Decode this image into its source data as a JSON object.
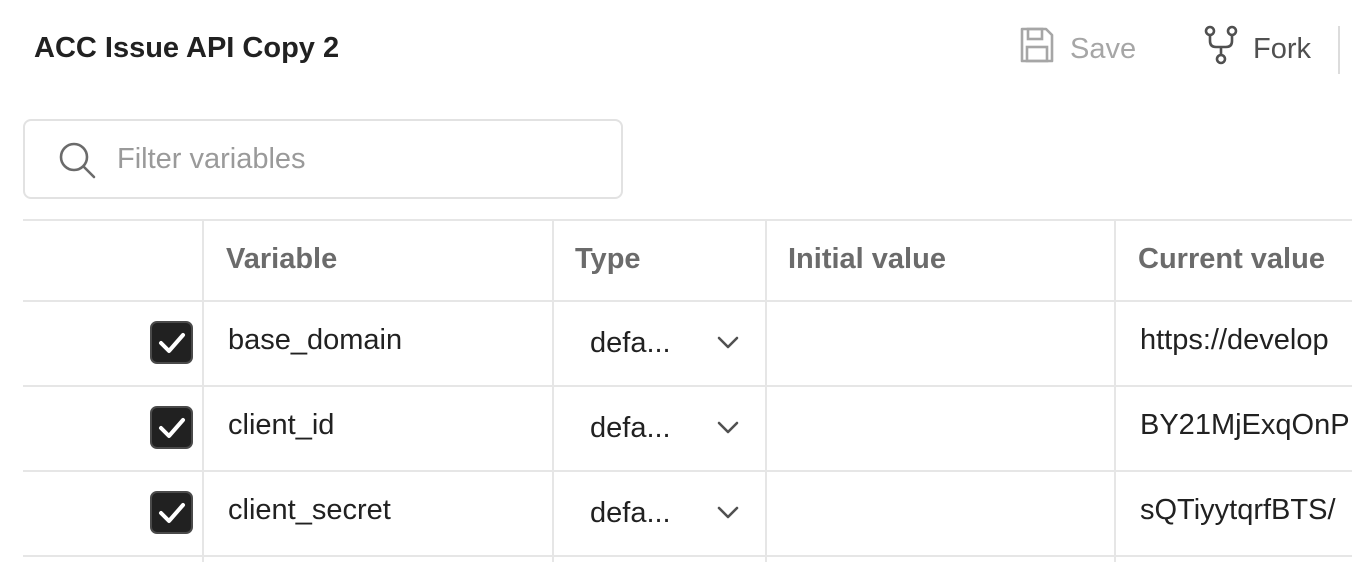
{
  "header": {
    "title": "ACC Issue API Copy 2",
    "save_label": "Save",
    "fork_label": "Fork"
  },
  "filter": {
    "placeholder": "Filter variables",
    "value": ""
  },
  "table": {
    "columns": {
      "variable": "Variable",
      "type": "Type",
      "initial_value": "Initial value",
      "current_value": "Current value"
    },
    "rows": [
      {
        "checked": true,
        "variable": "base_domain",
        "type": "defa...",
        "initial_value": "",
        "current_value": "https://develop"
      },
      {
        "checked": true,
        "variable": "client_id",
        "type": "defa...",
        "initial_value": "",
        "current_value": "BY21MjExqOnP"
      },
      {
        "checked": true,
        "variable": "client_secret",
        "type": "defa...",
        "initial_value": "",
        "current_value": "sQTiyytqrfBTS/"
      }
    ]
  },
  "colors": {
    "text": "#212121",
    "muted": "#9a9a9a",
    "header_text": "#6b6b6b",
    "border": "#e6e6e6",
    "checkbox_fill": "#212121"
  },
  "icons": {
    "save": "floppy-disk-icon",
    "fork": "fork-icon",
    "search": "search-icon",
    "checkbox": "checkmark-icon",
    "dropdown": "chevron-down-icon"
  }
}
